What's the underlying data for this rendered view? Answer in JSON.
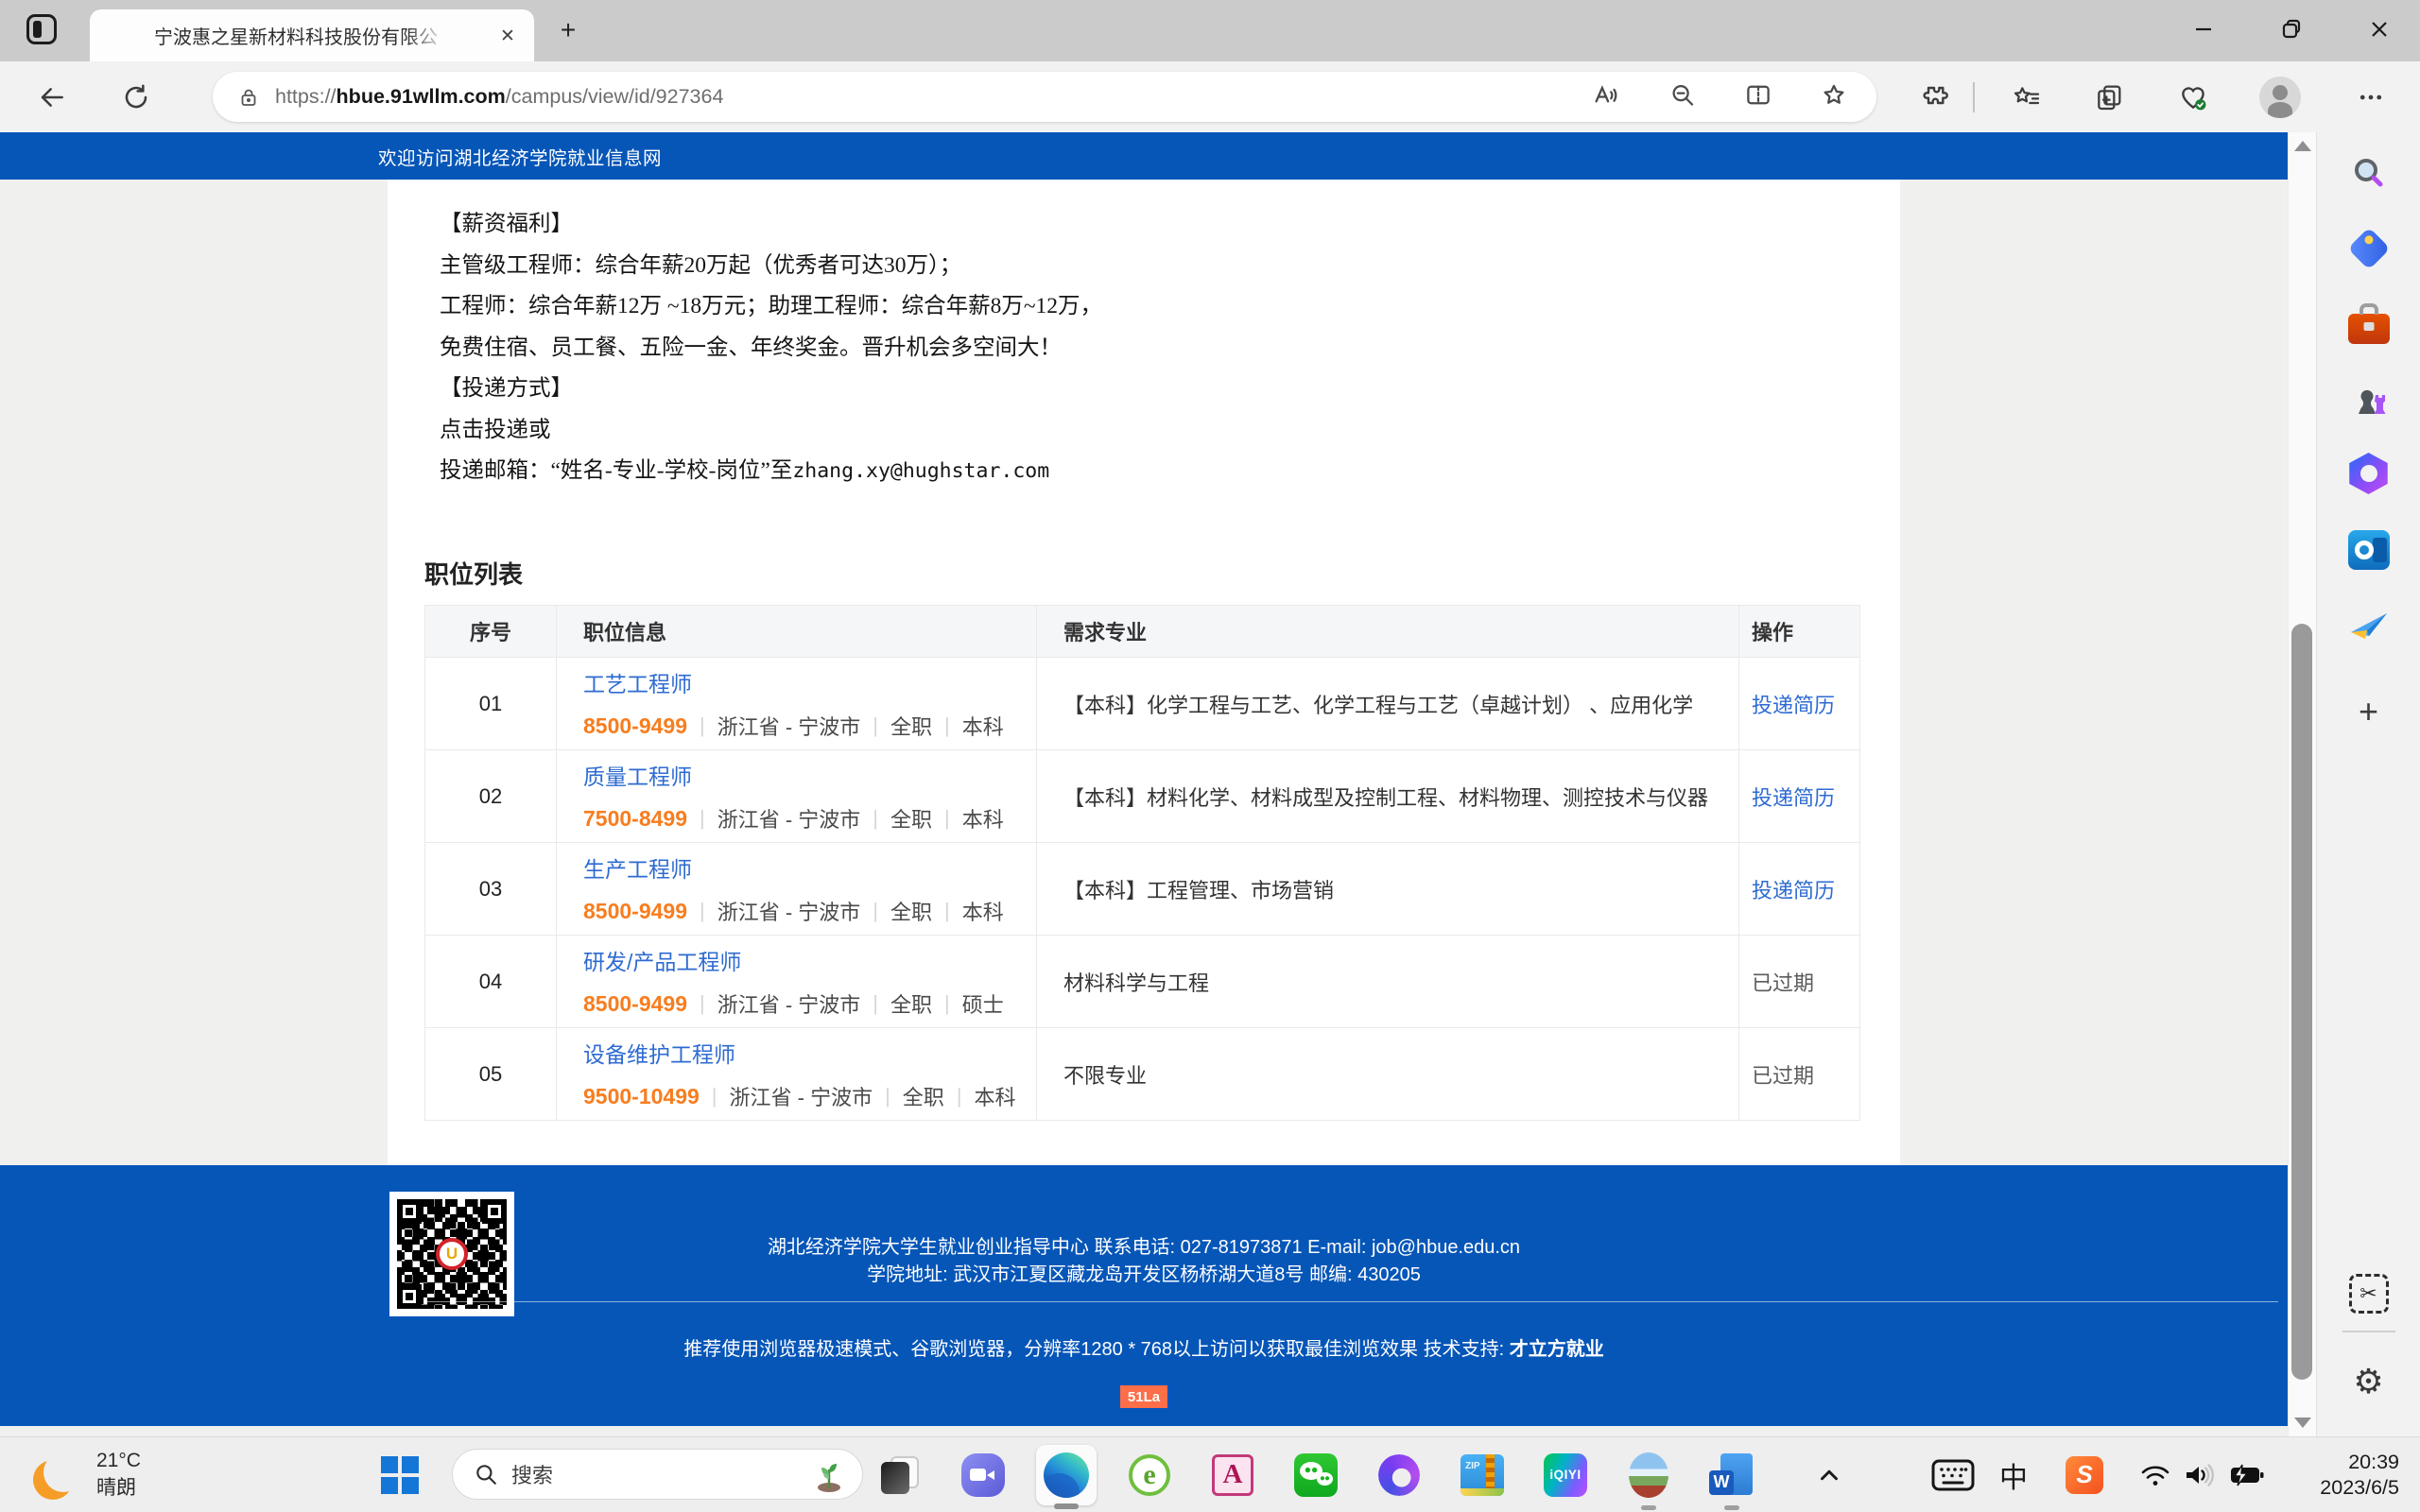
{
  "colors": {
    "primary_blue": "#0656b8",
    "link_blue": "#2e6bd2",
    "salary_orange": "#f87d1e",
    "badge_orange": "#fd6e49"
  },
  "browser": {
    "tab_title": "宁波惠之星新材料科技股份有限公",
    "url": {
      "scheme": "https://",
      "domain": "hbue.91wllm.com",
      "path": "/campus/view/id/927364"
    }
  },
  "page": {
    "welcome_bar": "欢迎访问湖北经济学院就业信息网",
    "intro": {
      "lines": [
        "【薪资福利】",
        "主管级工程师：综合年薪20万起（优秀者可达30万）；",
        "工程师：综合年薪12万 ~18万元；助理工程师：综合年薪8万~12万，",
        "免费住宿、员工餐、五险一金、年终奖金。晋升机会多空间大！",
        "【投递方式】",
        "点击投递或",
        "投递邮箱：“姓名-专业-学校-岗位”至"
      ],
      "email": "zhang.xy@hughstar.com"
    },
    "job_list": {
      "title": "职位列表",
      "headers": [
        "序号",
        "职位信息",
        "需求专业",
        "操作"
      ],
      "rows": [
        {
          "no": "01",
          "title": "工艺工程师",
          "salary": "8500-9499",
          "location": "浙江省 - 宁波市",
          "jobtype": "全职",
          "degree": "本科",
          "majors": "【本科】化学工程与工艺、化学工程与工艺（卓越计划） 、应用化学",
          "action": "投递简历"
        },
        {
          "no": "02",
          "title": "质量工程师",
          "salary": "7500-8499",
          "location": "浙江省 - 宁波市",
          "jobtype": "全职",
          "degree": "本科",
          "majors": "【本科】材料化学、材料成型及控制工程、材料物理、测控技术与仪器",
          "action": "投递简历"
        },
        {
          "no": "03",
          "title": "生产工程师",
          "salary": "8500-9499",
          "location": "浙江省 - 宁波市",
          "jobtype": "全职",
          "degree": "本科",
          "majors": "【本科】工程管理、市场营销",
          "action": "投递简历"
        },
        {
          "no": "04",
          "title": "研发/产品工程师",
          "salary": "8500-9499",
          "location": "浙江省 - 宁波市",
          "jobtype": "全职",
          "degree": "硕士",
          "majors": "材料科学与工程",
          "action": "已过期"
        },
        {
          "no": "05",
          "title": "设备维护工程师",
          "salary": "9500-10499",
          "location": "浙江省 - 宁波市",
          "jobtype": "全职",
          "degree": "本科",
          "majors": "不限专业",
          "action": "已过期"
        }
      ]
    },
    "footer": {
      "line1": "湖北经济学院大学生就业创业指导中心   联系电话: 027-81973871     E-mail: job@hbue.edu.cn",
      "line2": "学院地址: 武汉市江夏区藏龙岛开发区杨桥湖大道8号 邮编: 430205",
      "notice": "推荐使用浏览器极速模式、谷歌浏览器，分辨率1280 * 768以上访问以获取最佳浏览效果   技术支持: ",
      "support_link": "才立方就业",
      "badge": "51La"
    }
  },
  "taskbar": {
    "weather": {
      "temperature": "21°C",
      "condition": "晴朗"
    },
    "search_placeholder": "搜索",
    "ime": "中",
    "clock": {
      "time": "20:39",
      "date": "2023/6/5"
    },
    "labels": {
      "e360": "e",
      "access": "A",
      "zip": "ZIP",
      "iqiyi": "iQIYI",
      "word": "W",
      "sogou": "S",
      "qr_logo": "U"
    }
  }
}
